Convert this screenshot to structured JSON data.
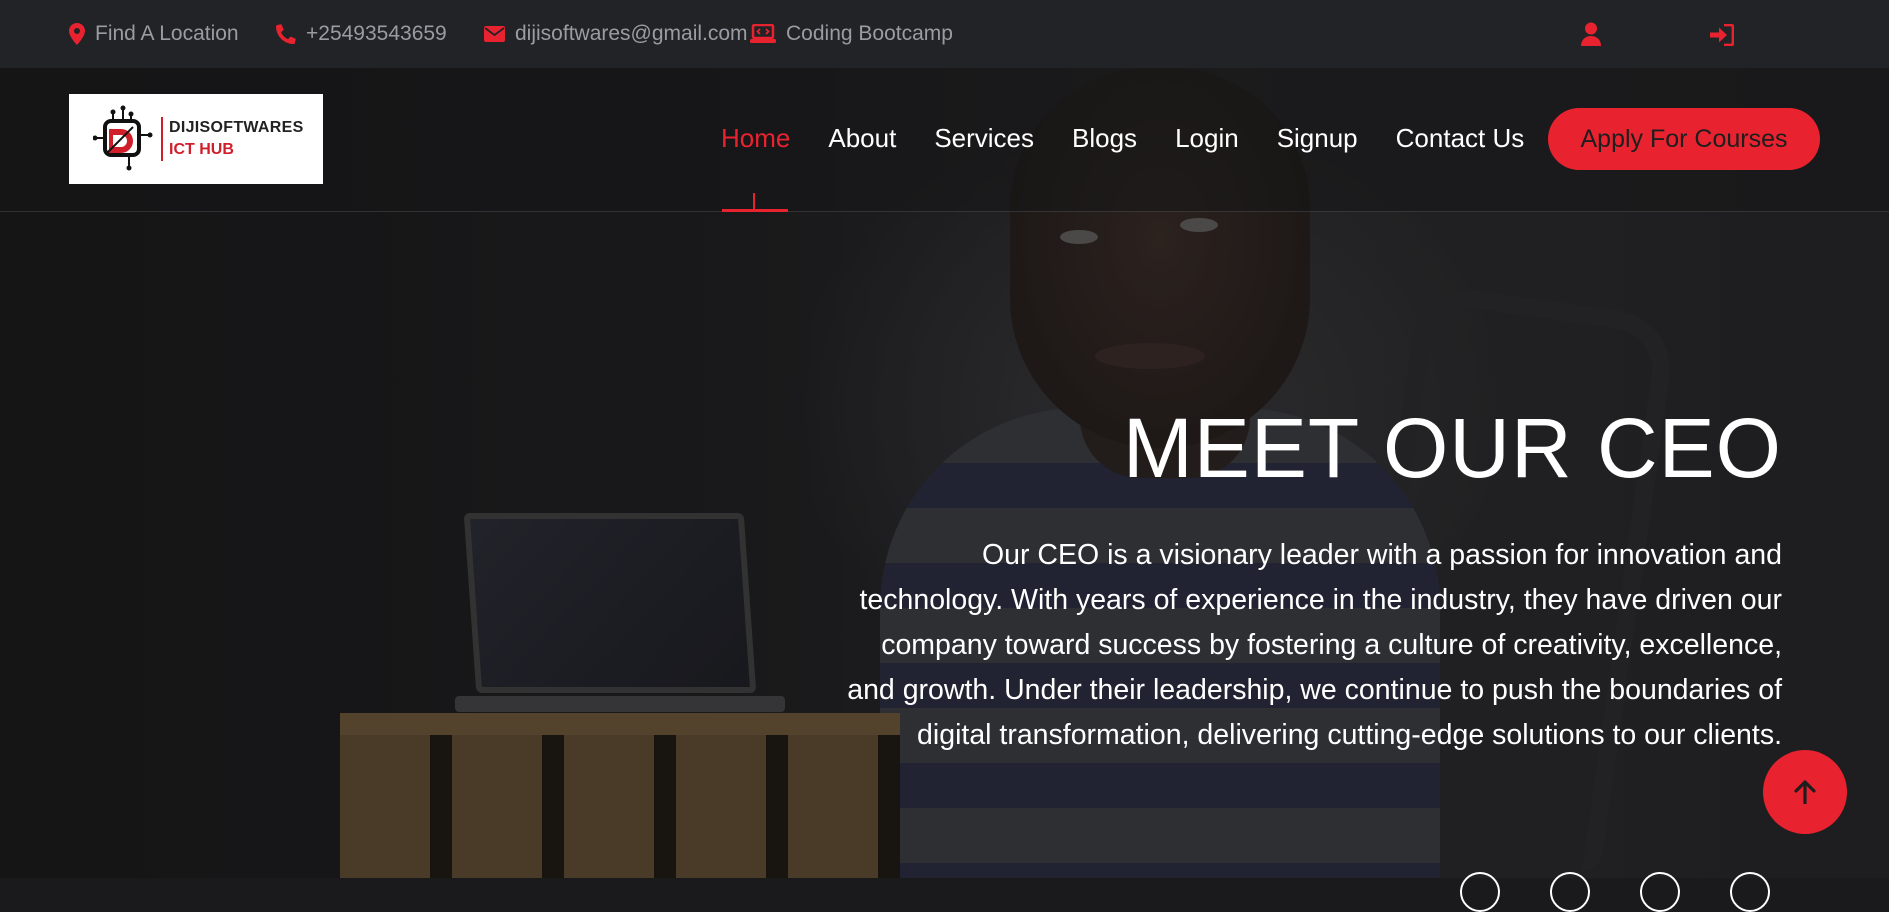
{
  "topbar": {
    "location": "Find A Location",
    "phone": "+25493543659",
    "email": "dijisoftwares@gmail.com",
    "bootcamp": "Coding Bootcamp"
  },
  "logo": {
    "line1": "DIJISOFTWARES",
    "line2": "ICT HUB"
  },
  "nav": {
    "items": [
      {
        "label": "Home"
      },
      {
        "label": "About"
      },
      {
        "label": "Services"
      },
      {
        "label": "Blogs"
      },
      {
        "label": "Login"
      },
      {
        "label": "Signup"
      },
      {
        "label": "Contact Us"
      }
    ],
    "active": "Home",
    "cta": "Apply For Courses"
  },
  "hero": {
    "title": "MEET OUR CEO",
    "description": "Our CEO is a visionary leader with a passion for innovation and technology. With years of experience in the industry, they have driven our company toward success by fostering a culture of creativity, excellence, and growth. Under their leadership, we continue to push the boundaries of digital transformation, delivering cutting-edge solutions to our clients."
  },
  "colors": {
    "accent": "#e8232f",
    "topbar_bg": "#212327",
    "topbar_text": "#9a9ca3",
    "white": "#ffffff"
  },
  "icons": {
    "location": "map-marker-icon",
    "phone": "phone-icon",
    "email": "envelope-icon",
    "bootcamp": "laptop-code-icon",
    "user": "user-icon",
    "login": "sign-in-icon",
    "back_to_top": "arrow-up-icon"
  }
}
